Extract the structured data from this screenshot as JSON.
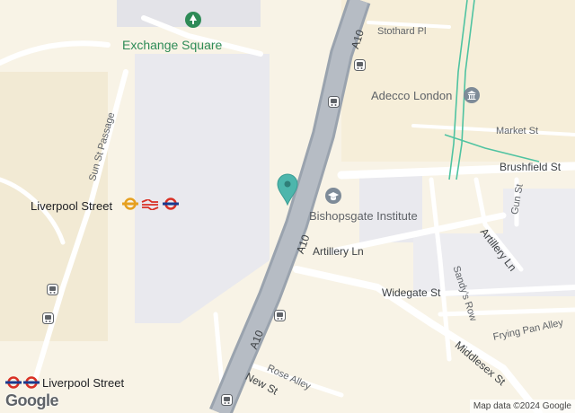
{
  "map": {
    "places": {
      "exchange_square": "Exchange Square",
      "adecco_london": "Adecco London",
      "bishopsgate_institute": "Bishopsgate Institute",
      "liverpool_street_station": "Liverpool Street",
      "liverpool_street_underground": "Liverpool Street"
    },
    "roads": {
      "a10_top": "A10",
      "a10_mid": "A10",
      "a10_bottom": "A10",
      "stothard_pl": "Stothard Pl",
      "market_st": "Market St",
      "brushfield_st": "Brushfield St",
      "sun_st_passage": "Sun St Passage",
      "artillery_ln": "Artillery Ln",
      "artillery_ln_2": "Artillery Ln",
      "gun_st": "Gun St",
      "widegate_st": "Widegate St",
      "sandys_row": "Sandy's Row",
      "frying_pan_alley": "Frying Pan Alley",
      "middlesex_st": "Middlesex St",
      "rose_alley": "Rose Alley",
      "new_st": "New St"
    },
    "attribution": "Map data ©2024 Google",
    "logo": "Google",
    "colors": {
      "base": "#f8f3e6",
      "block": "#f2e9d2",
      "built": "#e9e9ee",
      "highway": "#9aa3ae",
      "road": "#ffffff",
      "pin": "#4db6ac",
      "rail": "#4fc3a1"
    },
    "icons": [
      "tree-icon",
      "bus-stop-icon",
      "museum-icon",
      "school-icon",
      "location-pin-icon",
      "underground-icon",
      "national-rail-icon"
    ]
  }
}
